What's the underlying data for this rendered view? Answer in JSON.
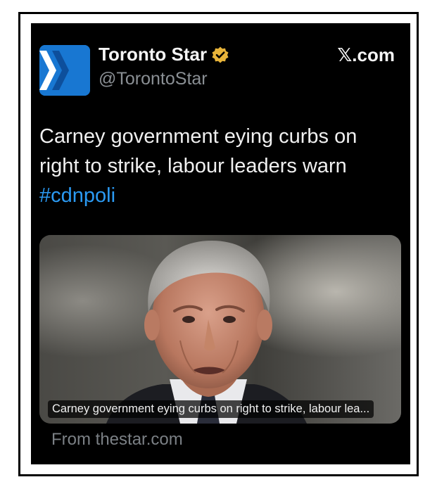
{
  "author": {
    "display_name": "Toronto Star",
    "handle": "@TorontoStar",
    "brand_color": "#1877d2",
    "verified_badge_color": "#e8b43a"
  },
  "platform_label": "𝕏.com",
  "tweet": {
    "text": "Carney government eying curbs on right to strike, labour leaders warn",
    "hashtag": "#cdnpoli",
    "hashtag_color": "#2b9af3"
  },
  "media": {
    "caption": "Carney government eying curbs on right to strike, labour lea...",
    "source": "From thestar.com"
  }
}
